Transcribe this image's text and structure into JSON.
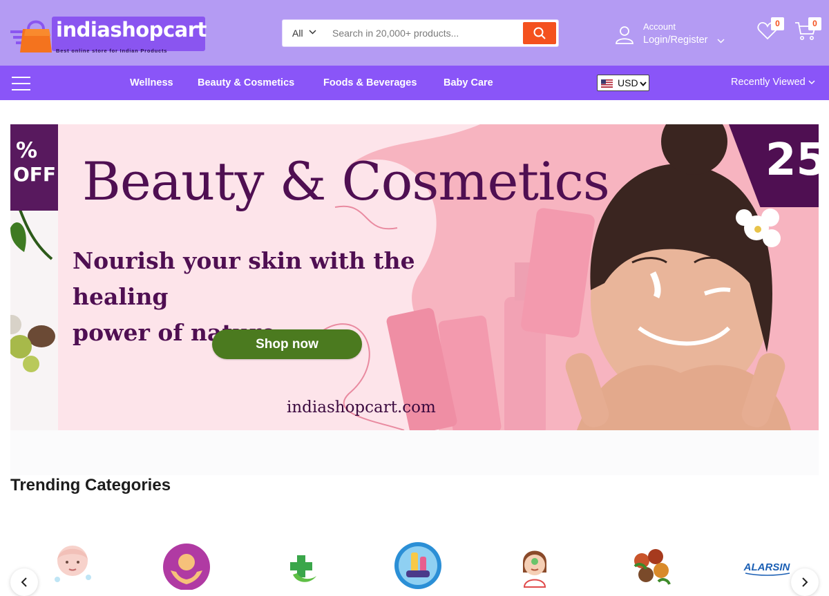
{
  "header": {
    "logo_text": "indiashopcart",
    "logo_tagline": "Best online store for Indian Products",
    "search": {
      "category": "All",
      "placeholder": "Search in 20,000+ products..."
    },
    "account": {
      "label": "Account",
      "action": "Login/Register"
    },
    "wishlist_count": "0",
    "cart_count": "0"
  },
  "nav": {
    "items": [
      "Wellness",
      "Beauty & Cosmetics",
      "Foods & Beverages",
      "Baby Care"
    ],
    "currency": "USD",
    "recently_viewed": "Recently Viewed"
  },
  "hero": {
    "off_symbol": "%",
    "off_word": "OFF",
    "title": "Beauty & Cosmetics",
    "subtitle_line1": "Nourish your skin with the healing",
    "subtitle_line2": "power of nature",
    "cta": "Shop now",
    "url": "indiashopcart.com",
    "discount_partial": "25"
  },
  "trending": {
    "title": "Trending Categories",
    "categories": [
      {
        "icon": "face-wash-icon"
      },
      {
        "icon": "baby-care-icon"
      },
      {
        "icon": "herbal-health-icon"
      },
      {
        "icon": "cosmetics-icon"
      },
      {
        "icon": "face-care-icon"
      },
      {
        "icon": "spices-icon"
      },
      {
        "icon": "alarsin-brand-logo",
        "logo_text": "ALARSIN"
      }
    ]
  },
  "colors": {
    "header_bg": "#b49bf3",
    "nav_bg": "#8a55f8",
    "accent": "#f4511e",
    "cta_green": "#4b7a1f",
    "hero_purple": "#4f0f52"
  }
}
